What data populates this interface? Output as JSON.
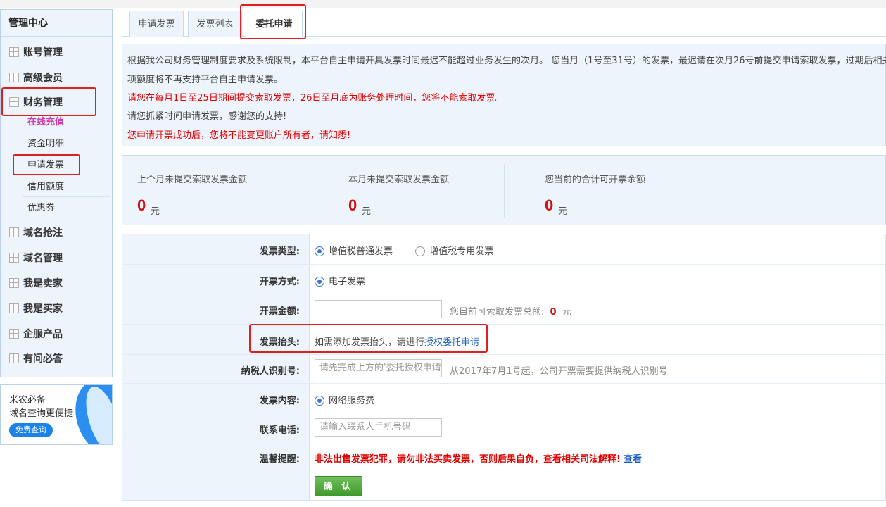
{
  "sidebar": {
    "title": "管理中心",
    "items": [
      {
        "label": "账号管理"
      },
      {
        "label": "高级会员"
      },
      {
        "label": "财务管理"
      },
      {
        "label": "域名抢注"
      },
      {
        "label": "域名管理"
      },
      {
        "label": "我是卖家"
      },
      {
        "label": "我是买家"
      },
      {
        "label": "企服产品"
      },
      {
        "label": "有问必答"
      }
    ],
    "finance_sub": [
      {
        "label": "在线充值"
      },
      {
        "label": "资金明细"
      },
      {
        "label": "申请发票"
      },
      {
        "label": "信用额度"
      },
      {
        "label": "优惠券"
      }
    ]
  },
  "ad": {
    "line1": "米农必备",
    "line2": "域名查询更便捷",
    "button": "免费查询"
  },
  "tabs": [
    {
      "label": "申请发票"
    },
    {
      "label": "发票列表"
    },
    {
      "label": "委托申请"
    }
  ],
  "notice": {
    "line1": "根据我公司财务管理制度要求及系统限制，本平台自主申请开具发票时间最迟不能超过业务发生的次月。 您当月（1号至31号）的发票，最迟请在次月26号前提交申请索取发票，过期后相关款",
    "line2": "项额度将不再支持平台自主申请发票。",
    "line3": "请您在每月1日至25日期间提交索取发票，26日至月底为账务处理时间，您将不能索取发票。",
    "line4": "请您抓紧时间申请发票，感谢您的支持!",
    "line5": "您申请开票成功后，您将不能变更账户所有者，请知悉!"
  },
  "stats": [
    {
      "label": "上个月未提交索取发票金额",
      "value": "0",
      "unit": "元"
    },
    {
      "label": "本月未提交索取发票金额",
      "value": "0",
      "unit": "元"
    },
    {
      "label": "您当前的合计可开票余额",
      "value": "0",
      "unit": "元"
    }
  ],
  "form": {
    "invoice_type_label": "发票类型:",
    "invoice_type_opt1": "增值税普通发票",
    "invoice_type_opt2": "增值税专用发票",
    "method_label": "开票方式:",
    "method_opt1": "电子发票",
    "amount_label": "开票金额:",
    "amount_hint": "您目前可索取发票总额:",
    "amount_total": "0",
    "amount_unit": "元",
    "header_label": "发票抬头:",
    "header_text": "如需添加发票抬头，请进行",
    "header_link": "授权委托申请",
    "taxid_label": "纳税人识别号:",
    "taxid_placeholder": "请先完成上方的'委托授权申请'",
    "taxid_hint": "从2017年7月1号起，公司开票需要提供纳税人识别号",
    "content_label": "发票内容:",
    "content_opt1": "网络服务费",
    "phone_label": "联系电话:",
    "phone_placeholder": "请输入联系人手机号码",
    "tip_label": "温馨提醒:",
    "tip_text": "非法出售发票犯罪，请勿非法买卖发票，否则后果自负，查看相关司法解释!",
    "tip_link": "查看",
    "confirm": "确 认"
  },
  "colors": {
    "accent_red": "#e00000",
    "link_blue": "#1f5fbf",
    "panel_bg": "#eef4fb",
    "confirm_green": "#4aa83a"
  }
}
